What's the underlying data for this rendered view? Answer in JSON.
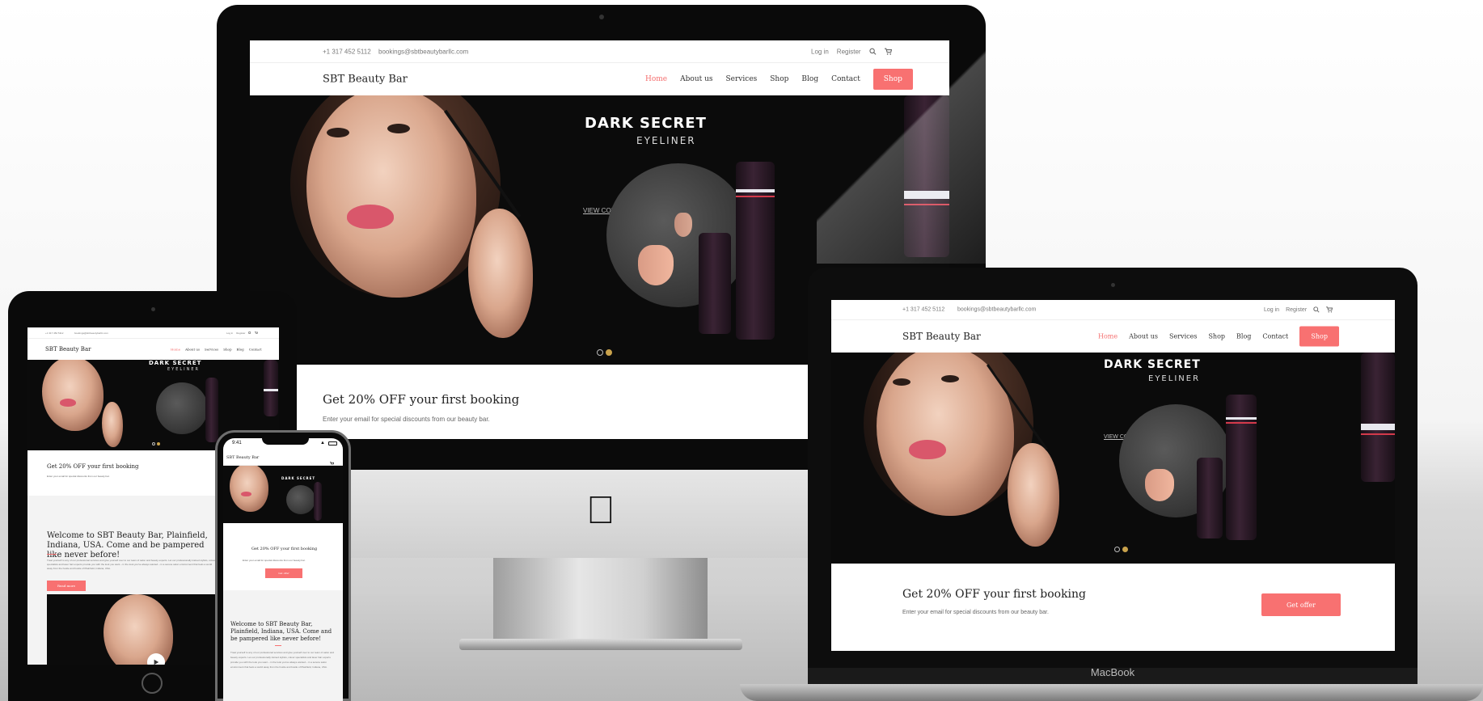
{
  "site": {
    "phone": "+1 317 452 5112",
    "email": "bookings@sbtbeautybarllc.com",
    "login": "Log in",
    "register": "Register",
    "brand": "SBT Beauty Bar",
    "nav": [
      "Home",
      "About us",
      "Services",
      "Shop",
      "Blog",
      "Contact"
    ],
    "shop_button": "Shop",
    "hero_title": "DARK SECRET",
    "hero_subtitle": "EYELINER",
    "hero_link": "VIEW COLLECTION",
    "offer_title": "Get 20% OFF your first booking",
    "offer_text": "Enter your email for special discounts from our beauty bar.",
    "offer_button": "Get offer",
    "welcome_title": "Welcome to SBT Beauty Bar, Plainfield, Indiana, USA. Come and be pampered like never before!",
    "welcome_text": "Treat yourself to any of our professional services and give yourself over to our team of salon and beauty experts. Let our professionally trained stylists, colour specialists and laser hair experts provide you with the look you want – in the look you've always wanted – in a serene salon environment that feels a world away from the hustle and bustle of Plainfield, Indiana, USA.",
    "read_more": "Read more"
  },
  "phone_status": {
    "time": "9:41"
  },
  "laptop_label": "MacBook",
  "colors": {
    "accent": "#f87171",
    "active_nav": "#f56f6f",
    "dot_active": "#c9a24c"
  }
}
